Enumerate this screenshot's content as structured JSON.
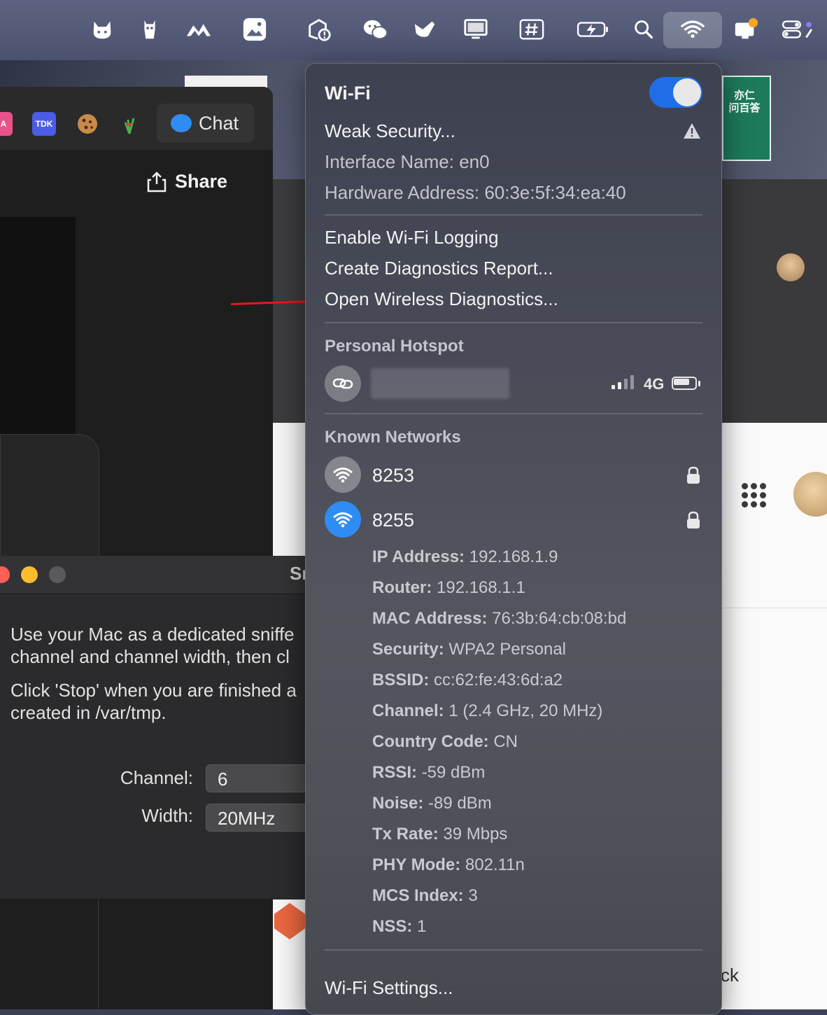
{
  "menubar": {
    "icons": [
      "cat-icon",
      "alpaca-icon",
      "mountain-icon",
      "photos-icon",
      "location-icon",
      "wechat-icon",
      "bird-icon",
      "display-icon",
      "hashtag-icon",
      "battery-charging-icon",
      "search-icon",
      "wifi-icon",
      "notification-icon",
      "control-center-icon"
    ]
  },
  "browser": {
    "extension_tdk": "TDK",
    "chat_label": "Chat",
    "share_label": "Share"
  },
  "sniffer": {
    "title_partial": "Sı",
    "paragraph1_line1": "Use your Mac as a dedicated sniffe",
    "paragraph1_line2": "channel and channel width, then cl",
    "paragraph2_line1": "Click 'Stop' when you are finished a",
    "paragraph2_line2": "created in /var/tmp.",
    "channel_label": "Channel:",
    "channel_value": "6",
    "width_label": "Width:",
    "width_value": "20MHz"
  },
  "background": {
    "book_text": "亦仁\n问百答",
    "partial_text": "ck"
  },
  "wifi_menu": {
    "title": "Wi-Fi",
    "toggle_on": true,
    "weak_security": "Weak Security...",
    "interface_name": "Interface Name: en0",
    "hardware_address": "Hardware Address: 60:3e:5f:34:ea:40",
    "actions": [
      "Enable Wi-Fi Logging",
      "Create Diagnostics Report...",
      "Open Wireless Diagnostics..."
    ],
    "hotspot_section": "Personal Hotspot",
    "hotspot_network_type": "4G",
    "known_section": "Known Networks",
    "networks": [
      {
        "name": "8253",
        "connected": false
      },
      {
        "name": "8255",
        "connected": true
      }
    ],
    "details": [
      {
        "label": "IP Address:",
        "value": "192.168.1.9"
      },
      {
        "label": "Router:",
        "value": "192.168.1.1"
      },
      {
        "label": "MAC Address:",
        "value": "76:3b:64:cb:08:bd"
      },
      {
        "label": "Security:",
        "value": "WPA2 Personal"
      },
      {
        "label": "BSSID:",
        "value": "cc:62:fe:43:6d:a2"
      },
      {
        "label": "Channel:",
        "value": "1 (2.4 GHz, 20 MHz)"
      },
      {
        "label": "Country Code:",
        "value": "CN"
      },
      {
        "label": "RSSI:",
        "value": "-59 dBm"
      },
      {
        "label": "Noise:",
        "value": "-89 dBm"
      },
      {
        "label": "Tx Rate:",
        "value": "39 Mbps"
      },
      {
        "label": "PHY Mode:",
        "value": "802.11n"
      },
      {
        "label": "MCS Index:",
        "value": "3"
      },
      {
        "label": "NSS:",
        "value": "1"
      }
    ],
    "settings": "Wi-Fi Settings..."
  },
  "colors": {
    "accent": "#1f6ee8",
    "wifi_connected": "#2f8cf2",
    "arrow": "#e8161b"
  }
}
